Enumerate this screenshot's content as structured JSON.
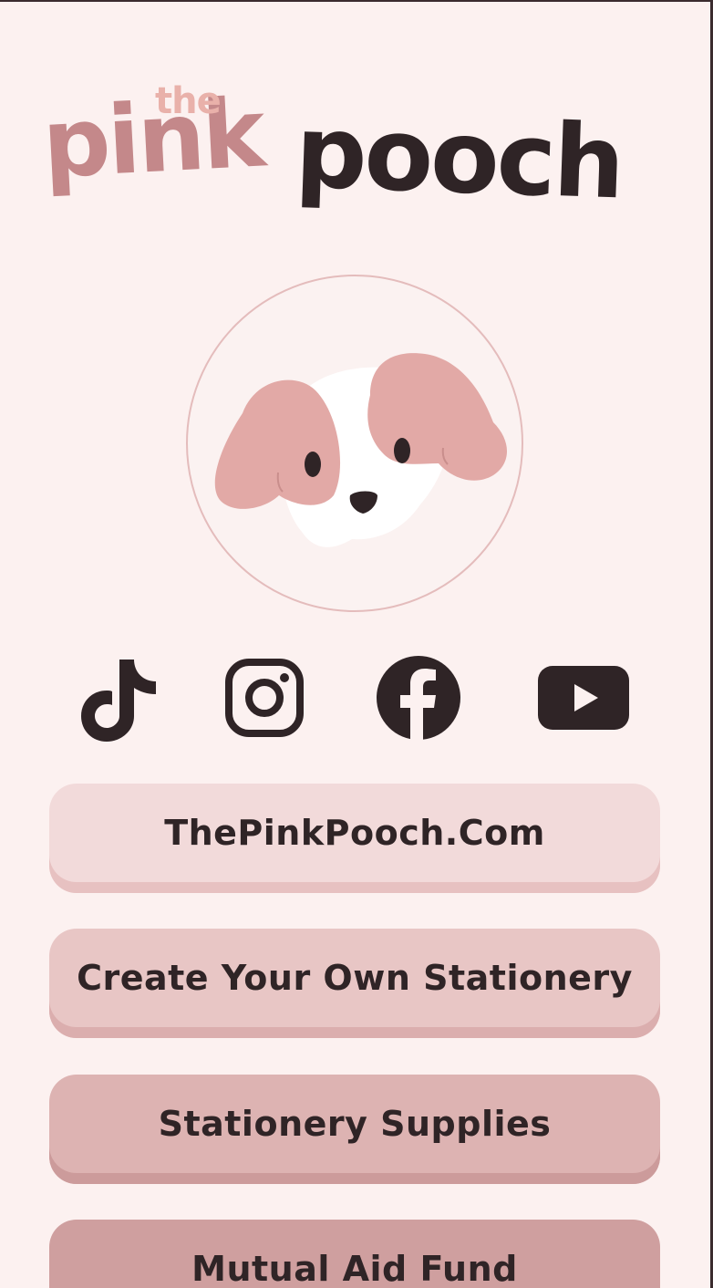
{
  "brand": {
    "the": "the",
    "pink": "pink",
    "pooch": "pooch"
  },
  "colors": {
    "background": "#fcf1f0",
    "text_dark": "#2f2426",
    "logo_pink": "#c4888a",
    "logo_the": "#e9b1aa",
    "dog_ears": "#e2a9a6"
  },
  "avatar": {
    "icon": "puppy-face-icon"
  },
  "socials": [
    {
      "name": "TikTok",
      "icon": "tiktok-icon"
    },
    {
      "name": "Instagram",
      "icon": "instagram-icon"
    },
    {
      "name": "Facebook",
      "icon": "facebook-icon"
    },
    {
      "name": "YouTube",
      "icon": "youtube-icon"
    }
  ],
  "links": [
    {
      "label": "ThePinkPooch.Com"
    },
    {
      "label": "Create Your Own Stationery"
    },
    {
      "label": "Stationery Supplies"
    },
    {
      "label": "Mutual Aid Fund"
    }
  ]
}
